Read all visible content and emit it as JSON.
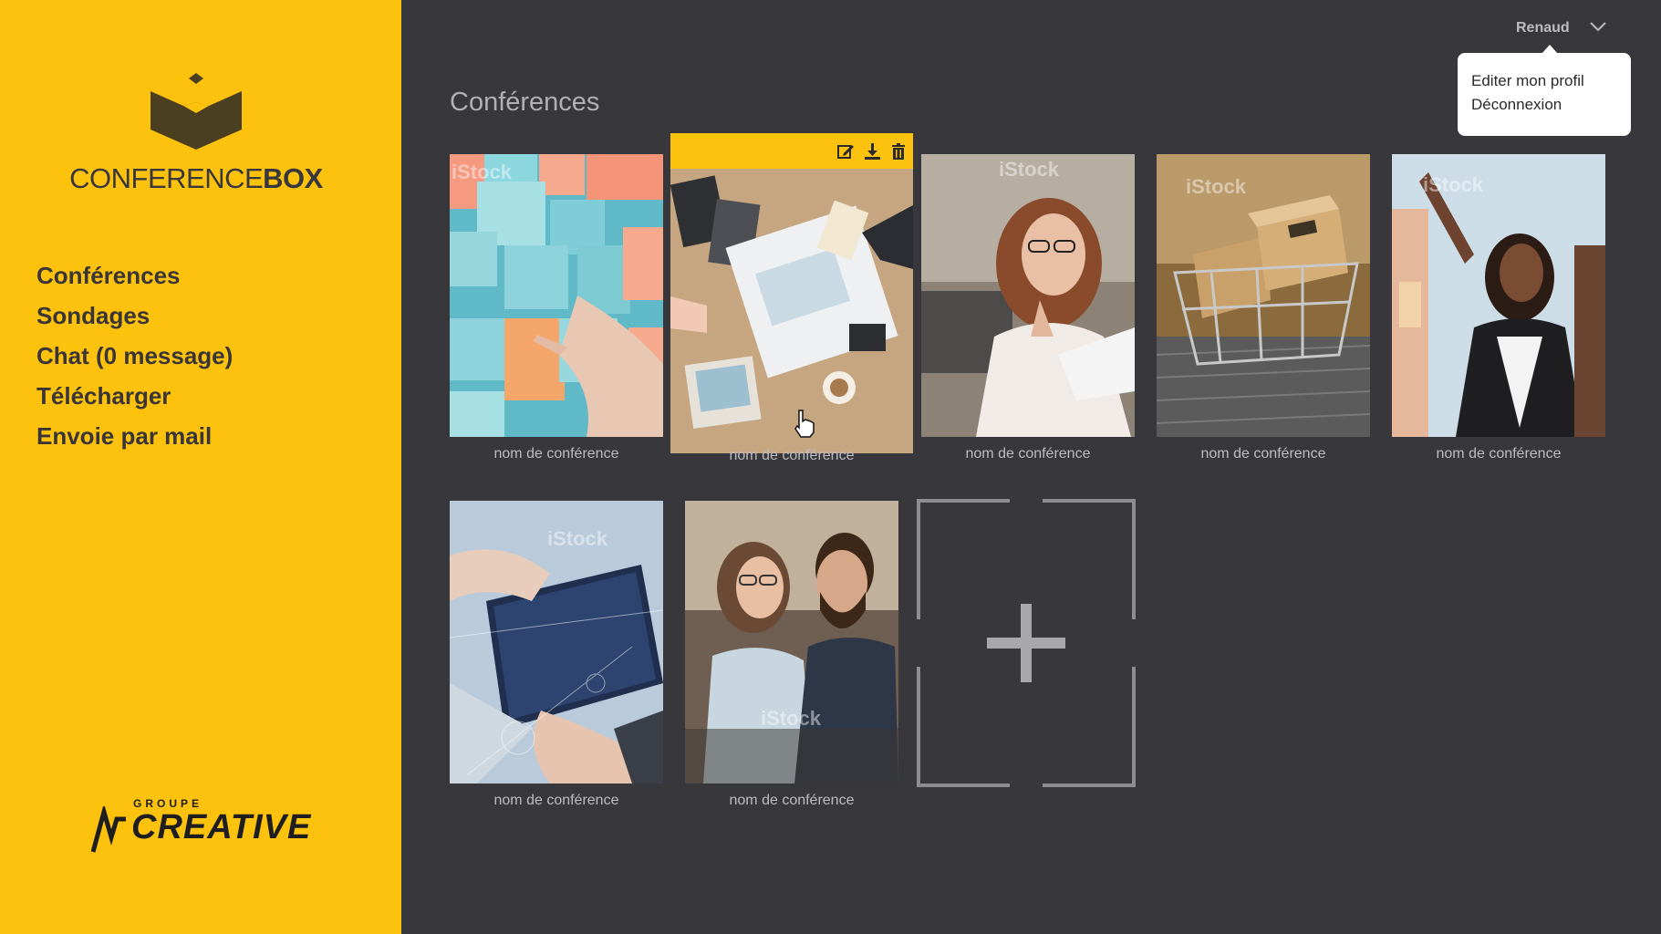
{
  "app": {
    "logo_text_light": "CONFERENCE",
    "logo_text_bold": "BOX",
    "brand_groupe": "GROUPE",
    "brand_name": "CREATIVE"
  },
  "sidebar": {
    "items": [
      {
        "label": "Conférences"
      },
      {
        "label": "Sondages"
      },
      {
        "label": "Chat (0 message)"
      },
      {
        "label": "Télécharger"
      },
      {
        "label": "Envoie par mail"
      }
    ]
  },
  "header": {
    "user_name": "Renaud",
    "user_menu": [
      {
        "label": "Editer mon profil"
      },
      {
        "label": "Déconnexion"
      }
    ]
  },
  "main": {
    "title": "Conférences",
    "conferences": [
      {
        "label": "nom de conférence"
      },
      {
        "label": "nom de conférence"
      },
      {
        "label": "nom de conférence"
      },
      {
        "label": "nom de conférence"
      },
      {
        "label": "nom de conférence"
      },
      {
        "label": "nom de conférence"
      },
      {
        "label": "nom de conférence"
      }
    ],
    "watermark": "iStock",
    "selected_index": 1,
    "selected_tools": [
      "edit-icon",
      "download-icon",
      "trash-icon"
    ]
  },
  "colors": {
    "sidebar": "#fdc20d",
    "background": "#38373c",
    "text_muted": "#bdbdc1",
    "accent": "#fdc20d"
  }
}
